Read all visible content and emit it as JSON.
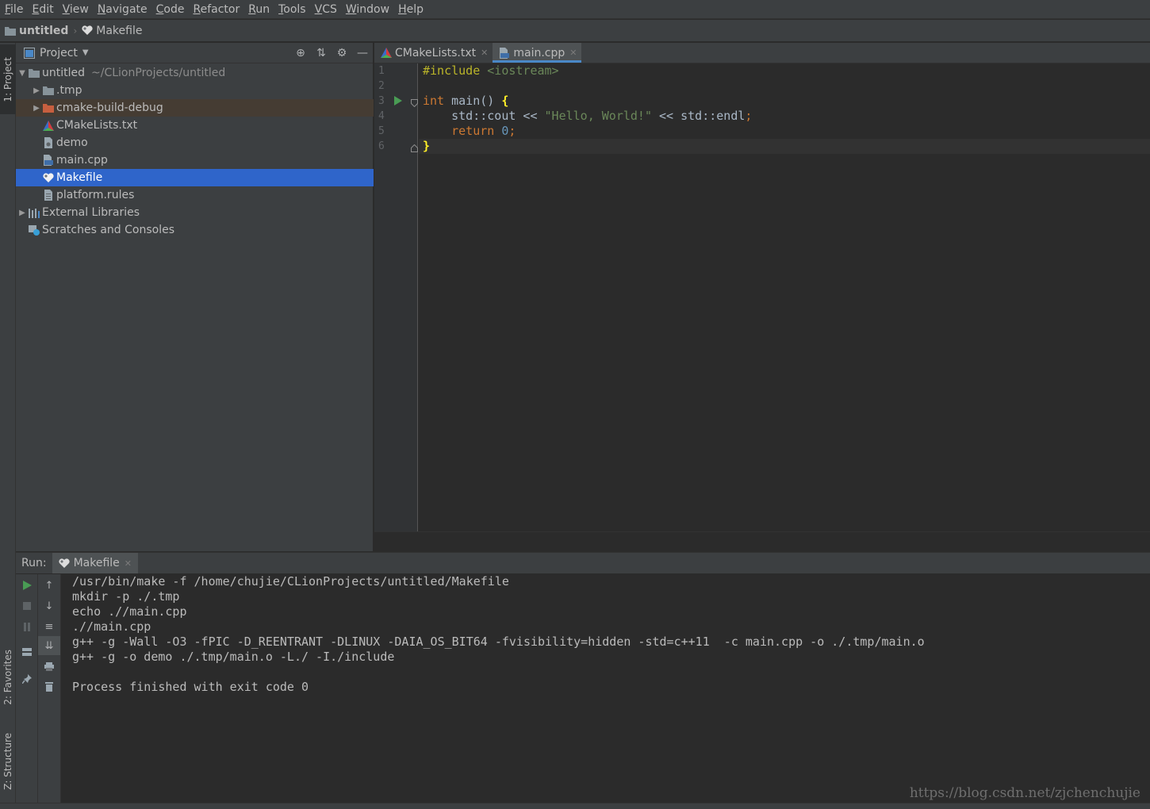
{
  "menu": [
    "File",
    "Edit",
    "View",
    "Navigate",
    "Code",
    "Refactor",
    "Run",
    "Tools",
    "VCS",
    "Window",
    "Help"
  ],
  "breadcrumb": {
    "project": "untitled",
    "file": "Makefile"
  },
  "left_strip": {
    "project": "1: Project",
    "favorites": "2: Favorites",
    "structure": "Z: Structure"
  },
  "project_panel": {
    "title": "Project",
    "tree": [
      {
        "label": "untitled",
        "sub": "~/CLionProjects/untitled"
      },
      {
        "label": ".tmp"
      },
      {
        "label": "cmake-build-debug"
      },
      {
        "label": "CMakeLists.txt"
      },
      {
        "label": "demo"
      },
      {
        "label": "main.cpp"
      },
      {
        "label": "Makefile"
      },
      {
        "label": "platform.rules"
      },
      {
        "label": "External Libraries"
      },
      {
        "label": "Scratches and Consoles"
      }
    ]
  },
  "editor": {
    "tabs": [
      {
        "label": "CMakeLists.txt"
      },
      {
        "label": "main.cpp"
      }
    ],
    "line_numbers": [
      "1",
      "2",
      "3",
      "4",
      "5",
      "6"
    ]
  },
  "run_panel": {
    "label": "Run:",
    "tab": "Makefile",
    "output": [
      "/usr/bin/make -f /home/chujie/CLionProjects/untitled/Makefile",
      "mkdir -p ./.tmp",
      "echo .//main.cpp",
      ".//main.cpp",
      "g++ -g -Wall -O3 -fPIC -D_REENTRANT -DLINUX -DAIA_OS_BIT64 -fvisibility=hidden -std=c++11  -c main.cpp -o ./.tmp/main.o",
      "g++ -g -o demo ./.tmp/main.o -L./ -I./include",
      "",
      "Process finished with exit code 0"
    ]
  },
  "watermark": "https://blog.csdn.net/zjchenchujie",
  "colors": {
    "selection": "#2f65ca",
    "keyword": "#cc7832",
    "string": "#6a8759",
    "number": "#6897bb",
    "folder": "#87939a",
    "excluded_folder": "#c75f3f"
  }
}
